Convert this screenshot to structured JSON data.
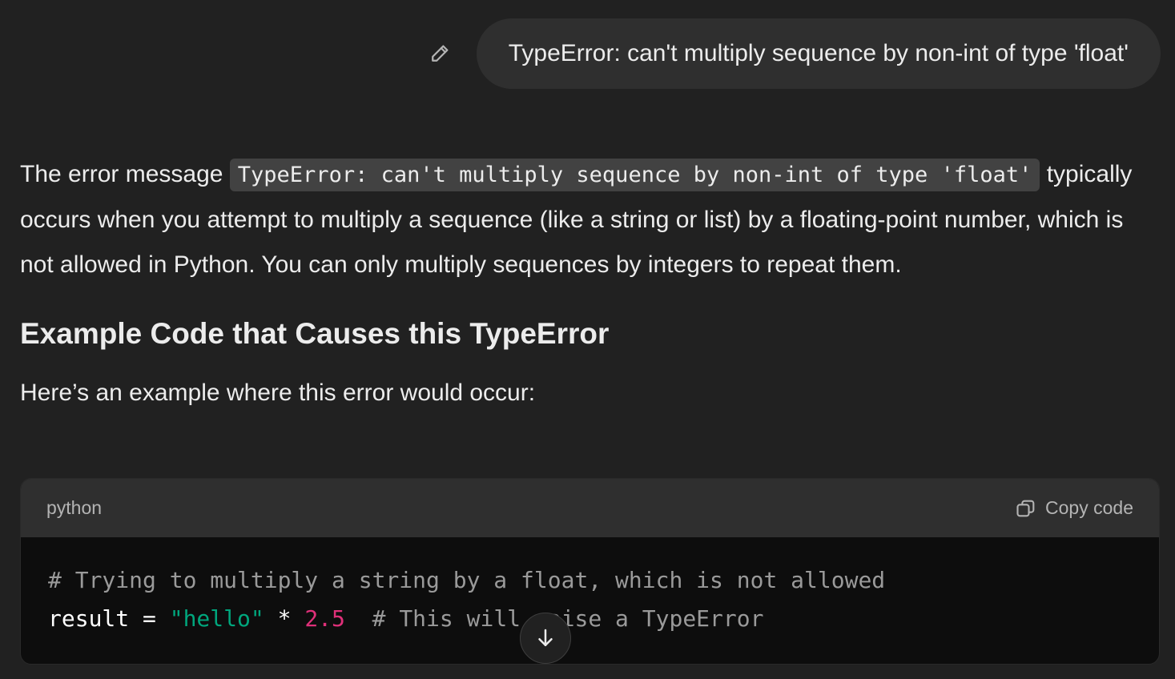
{
  "user_message": {
    "text": "TypeError: can't multiply sequence by non-int of type 'float'",
    "edit_icon": "pencil-icon"
  },
  "assistant": {
    "intro_before": "The error message ",
    "intro_code": "TypeError: can't multiply sequence by non-int of type 'float'",
    "intro_after": " typically occurs when you attempt to multiply a sequence (like a string or list) by a floating-point number, which is not allowed in Python. You can only multiply sequences by integers to repeat them.",
    "heading": "Example Code that Causes this TypeError",
    "example_intro": "Here’s an example where this error would occur:",
    "code_block": {
      "language": "python",
      "copy_label": "Copy code",
      "copy_icon": "copy-icon",
      "line1_comment": "# Trying to multiply a string by a float, which is not allowed",
      "line2_var": "result = ",
      "line2_string": "\"hello\"",
      "line2_op": " * ",
      "line2_number": "2.5",
      "line2_comment": "  # This will raise a TypeError"
    }
  },
  "scroll_button_icon": "arrow-down-icon"
}
